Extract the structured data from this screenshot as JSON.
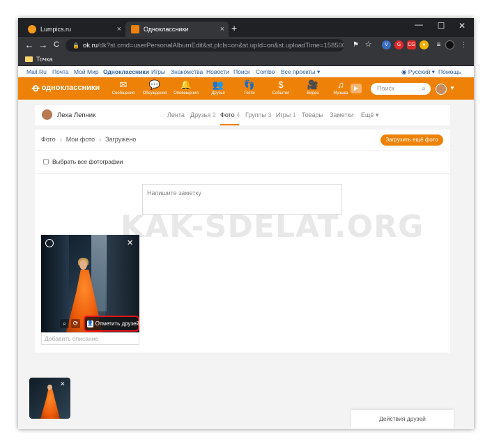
{
  "browser": {
    "tabs": [
      {
        "title": "Lumpics.ru",
        "close": "×",
        "favicon_color": "#f29a1c"
      },
      {
        "title": "Одноклассники",
        "close": "×",
        "favicon_color": "#ee8208"
      }
    ],
    "new_tab": "+",
    "window_controls": {
      "minimize": "—",
      "maximize": "☐",
      "close": "✕"
    },
    "nav": {
      "back": "←",
      "forward": "→",
      "reload": "C"
    },
    "url_host": "ok.ru",
    "url_rest": "/dk?st.cmd=userPersonalAlbumEdit&st.plcls=on&st.upId=on&st.uploadTime=158500027...",
    "bookmark": "Точка"
  },
  "topnav": {
    "links": [
      "Mail.Ru",
      "Почта",
      "Мой Мир",
      "Одноклассники",
      "Игры",
      "Знакомства",
      "Новости",
      "Поиск",
      "Combo",
      "Все проекты ▾"
    ],
    "language": "Русский ▾",
    "help": "Помощь"
  },
  "okbar": {
    "logo": "одноклассники",
    "items": [
      {
        "label": "Сообщения",
        "icon": "✉"
      },
      {
        "label": "Обсуждения",
        "icon": "💬"
      },
      {
        "label": "Оповещения",
        "icon": "🔔"
      },
      {
        "label": "Друзья",
        "icon": "👥"
      },
      {
        "label": "Гости",
        "icon": "👣"
      },
      {
        "label": "События",
        "icon": "$"
      },
      {
        "label": "Видео",
        "icon": "🎥"
      },
      {
        "label": "Музыка",
        "icon": "♫"
      }
    ],
    "search_placeholder": "Поиск"
  },
  "profile": {
    "name": "Леха Лепник",
    "tabs": [
      {
        "label": "Лента",
        "count": ""
      },
      {
        "label": "Друзья",
        "count": "2"
      },
      {
        "label": "Фото",
        "count": "4"
      },
      {
        "label": "Группы",
        "count": "3"
      },
      {
        "label": "Игры",
        "count": "1"
      },
      {
        "label": "Товары",
        "count": ""
      },
      {
        "label": "Заметки",
        "count": ""
      },
      {
        "label": "Ещё ▾",
        "count": ""
      }
    ]
  },
  "album": {
    "breadcrumb": [
      "Фото",
      "Мои фото",
      "Загружено"
    ],
    "upload_more": "Загрузить ещё фото",
    "select_all": "Выбрать все фотографии",
    "note_placeholder": "Напишите заметку",
    "photo": {
      "tag_friends": "Отметить друзей",
      "desc_placeholder": "Добавить описание"
    }
  },
  "watermark": "KAK-SDELAT.ORG",
  "friends_actions": "Действия друзей",
  "colors": {
    "brand": "#ee8208",
    "highlight": "#e3131b"
  }
}
